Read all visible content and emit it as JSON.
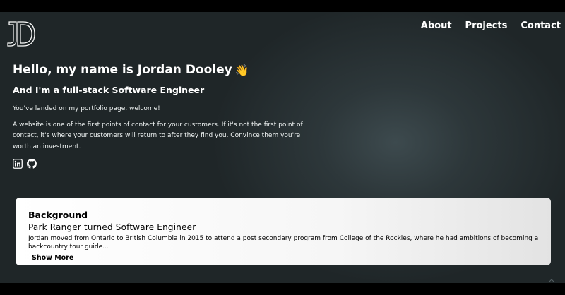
{
  "nav": {
    "items": [
      "About",
      "Projects",
      "Contact"
    ]
  },
  "logo": {
    "text": "JD"
  },
  "hero": {
    "title": "Hello, my name is Jordan Dooley",
    "wave": "👋",
    "subtitle": "And I'm a full-stack Software Engineer",
    "para1": "You've landed on my portfolio page, welcome!",
    "para2": "A website is one of the first points of contact for your customers. If it's not the first point of contact, it's where your customers will return to after they find you. Convince them you're worth an investment."
  },
  "socials": [
    "linkedin-icon",
    "github-icon"
  ],
  "background_card": {
    "heading": "Background",
    "subheading": "Park Ranger turned Software Engineer",
    "body": "Jordan moved from Ontario to British Columbia in 2015 to attend a post secondary program from College of the Rockies, where he had ambitions of becoming a backcountry tour guide...",
    "show_more": "Show More"
  },
  "colors": {
    "page_bg": "#2d373a",
    "card_bg": "#ffffff",
    "text": "#ffffff"
  }
}
